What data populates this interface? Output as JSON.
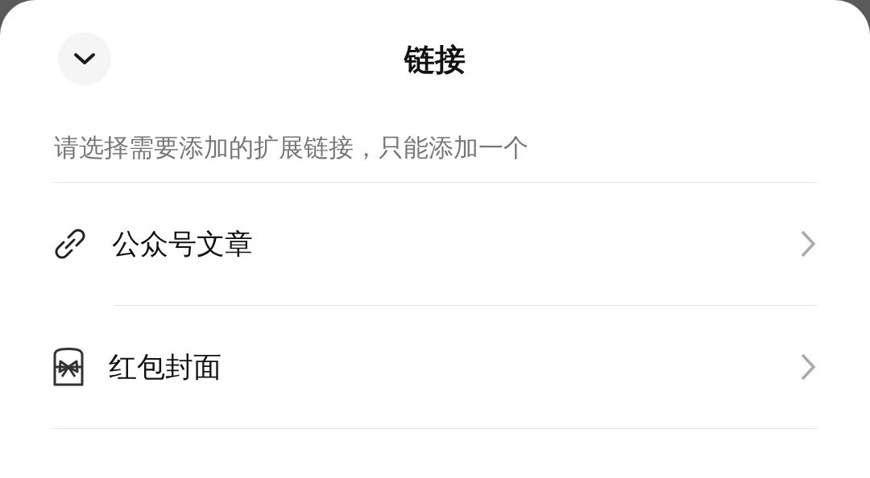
{
  "header": {
    "title": "链接"
  },
  "hint": "请选择需要添加的扩展链接，只能添加一个",
  "items": [
    {
      "kind": "link",
      "label": "公众号文章"
    },
    {
      "kind": "envelope",
      "label": "红包封面"
    }
  ]
}
